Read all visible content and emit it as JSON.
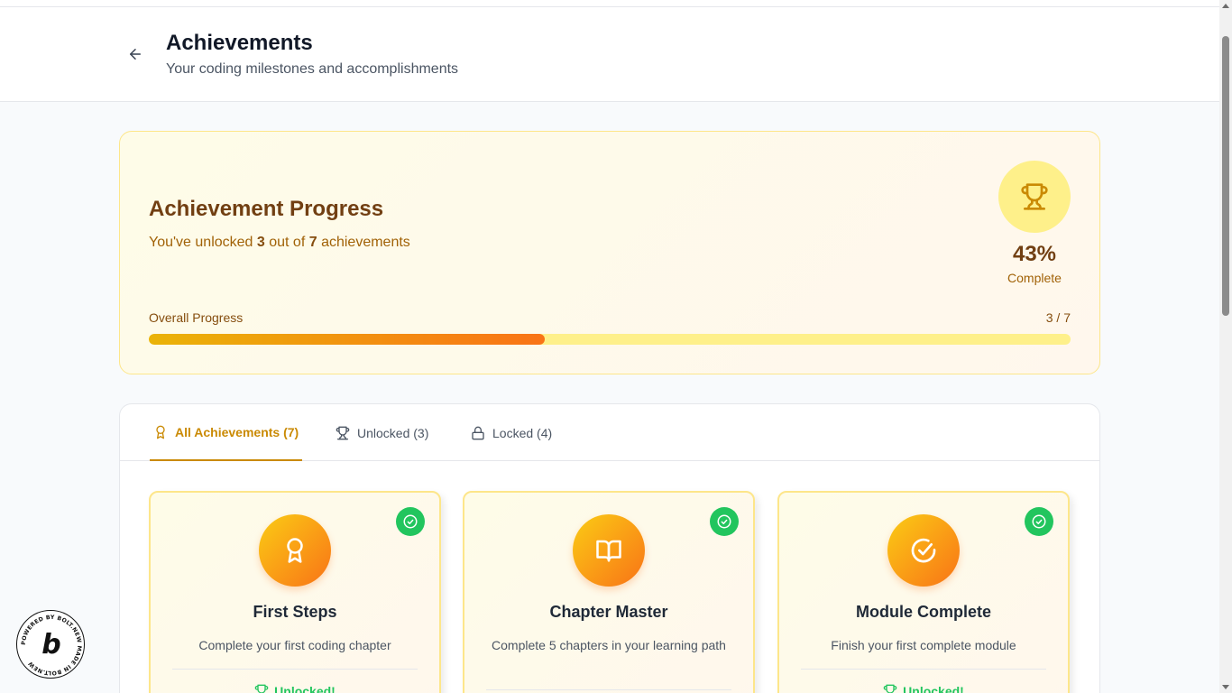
{
  "header": {
    "title": "Achievements",
    "subtitle": "Your coding milestones and accomplishments"
  },
  "progress": {
    "title": "Achievement Progress",
    "text_prefix": "You've unlocked ",
    "unlocked": "3",
    "text_middle": " out of ",
    "total": "7",
    "text_suffix": " achievements",
    "percent": "43%",
    "percent_label": "Complete",
    "overall_label": "Overall Progress",
    "overall_count": "3 / 7",
    "fraction": 0.43
  },
  "tabs": [
    {
      "label": "All Achievements (7)",
      "icon": "award-icon",
      "active": true
    },
    {
      "label": "Unlocked (3)",
      "icon": "trophy-icon",
      "active": false
    },
    {
      "label": "Locked (4)",
      "icon": "lock-icon",
      "active": false
    }
  ],
  "achievements": [
    {
      "title": "First Steps",
      "description": "Complete your first coding chapter",
      "icon": "award-icon",
      "status": "Unlocked!"
    },
    {
      "title": "Chapter Master",
      "description": "Complete 5 chapters in your learning path",
      "icon": "book-open-icon",
      "status": "Unlocked!"
    },
    {
      "title": "Module Complete",
      "description": "Finish your first complete module",
      "icon": "circle-check-icon",
      "status": "Unlocked!"
    }
  ],
  "badge": {
    "text": "POWERED BY BOLT.NEW MADE IN BOLT.NEW"
  },
  "colors": {
    "accent": "#ca8a04",
    "success": "#22c55e",
    "title_brown": "#713f12"
  }
}
